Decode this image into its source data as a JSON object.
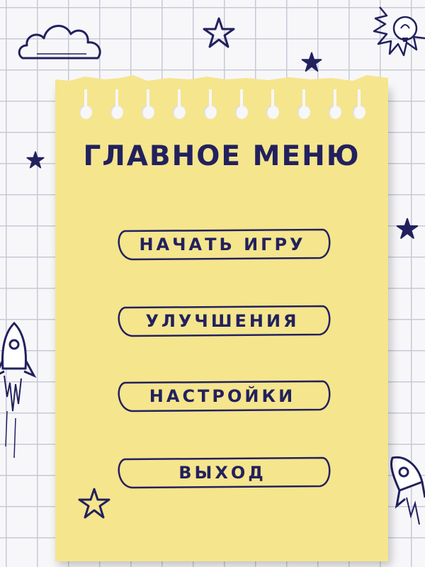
{
  "menu": {
    "title": "ГЛАВНОЕ МЕНЮ",
    "buttons": [
      {
        "label": "НАЧАТЬ ИГРУ"
      },
      {
        "label": "УЛУЧШЕНИЯ"
      },
      {
        "label": "НАСТРОЙКИ"
      },
      {
        "label": "ВЫХОД"
      }
    ]
  },
  "colors": {
    "ink": "#22215e",
    "note_paper": "#f5e58d",
    "grid_background": "#f7f7fa",
    "grid_lines": "#c9c9d6"
  },
  "doodles": [
    "cloud-icon",
    "star-icon",
    "lightbulb-sun-icon",
    "rocket-icon"
  ]
}
